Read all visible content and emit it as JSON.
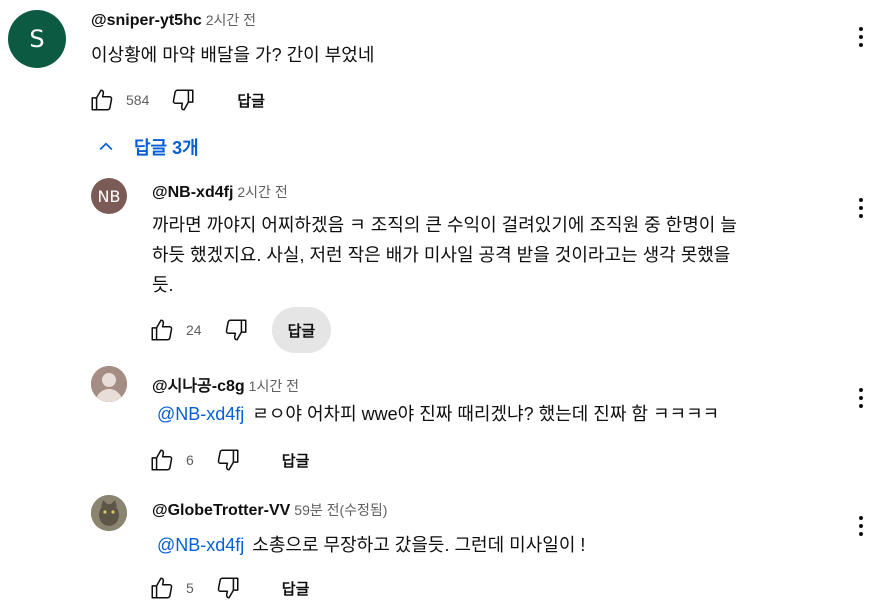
{
  "top_comment": {
    "avatar_letter": "S",
    "author": "@sniper-yt5hc",
    "time": "2시간 전",
    "text": "이상황에 마약 배달을 가? 간이 부었네",
    "likes": "584",
    "reply_label": "답글",
    "replies_toggle": "답글 3개"
  },
  "replies": [
    {
      "avatar_text": "NB",
      "author": "@NB-xd4fj",
      "time": "2시간 전",
      "text_line1": "까라면 까야지 어찌하겠음 ㅋ 조직의 큰 수익이 걸려있기에 조직원 중 한명이 늘",
      "text_line2": "하듯 했겠지요. 사실, 저런 작은 배가 미사일 공격 받을 것이라고는 생각 못했을",
      "text_line3": "듯.",
      "likes": "24",
      "reply_label": "답글"
    },
    {
      "author": "@시나공-c8g",
      "time": "1시간 전",
      "mention": "@NB-xd4fj",
      "text": "ㄹㅇ야 어차피 wwe야 진짜 때리겠냐? 했는데 진짜 함 ㅋㅋㅋㅋ",
      "likes": "6",
      "reply_label": "답글"
    },
    {
      "author": "@GlobeTrotter-VV",
      "time": "59분 전(수정됨)",
      "mention": "@NB-xd4fj",
      "text": "소총으로 무장하고 갔을듯. 그런데 미사일이 !",
      "likes": "5",
      "reply_label": "답글"
    }
  ],
  "colors": {
    "link": "#065fd4",
    "top_avatar": "#0d5a43",
    "meta": "#606060"
  },
  "icons": [
    "thumb-up-icon",
    "thumb-down-icon",
    "more-vert-icon",
    "chevron-up-icon"
  ]
}
